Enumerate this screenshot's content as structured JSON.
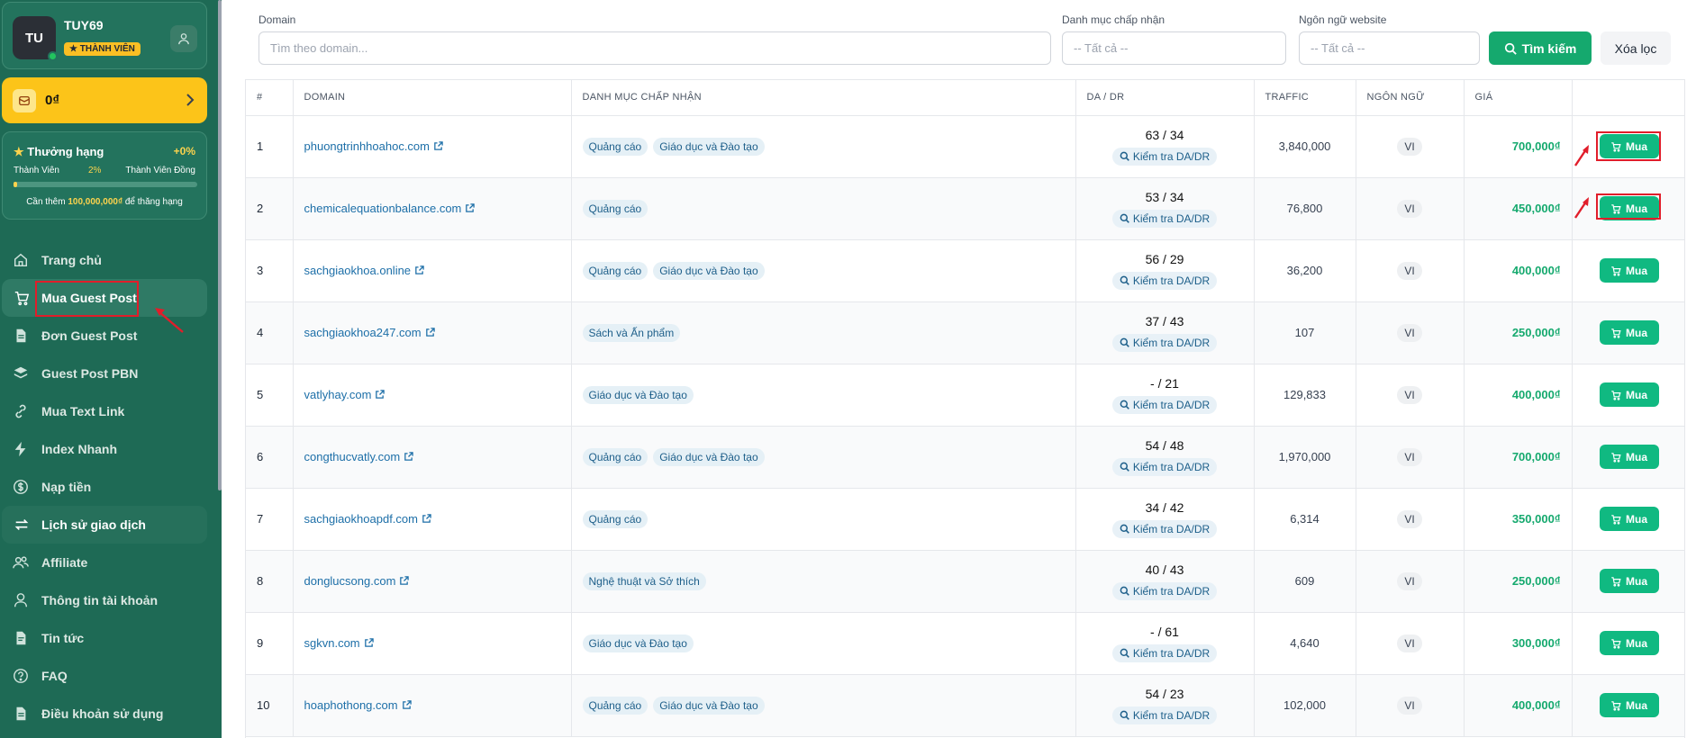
{
  "user": {
    "initials": "TU",
    "name": "TUY69",
    "badge": "★ THÀNH VIÊN"
  },
  "wallet": {
    "balance": "0₫"
  },
  "rank": {
    "title": "Thưởng hạng",
    "percent": "+0%",
    "from": "Thành Viên",
    "progress_label": "2%",
    "progress": 0.02,
    "to": "Thành Viên Đồng",
    "note_prefix": "Cần thêm ",
    "note_amount": "100,000,000₫",
    "note_suffix": " để thăng hạng"
  },
  "nav": [
    {
      "label": "Trang chủ",
      "icon": "home-icon"
    },
    {
      "label": "Mua Guest Post",
      "icon": "cart-icon"
    },
    {
      "label": "Đơn Guest Post",
      "icon": "document-icon"
    },
    {
      "label": "Guest Post PBN",
      "icon": "layers-icon"
    },
    {
      "label": "Mua Text Link",
      "icon": "link-icon"
    },
    {
      "label": "Index Nhanh",
      "icon": "bolt-icon"
    },
    {
      "label": "Nạp tiền",
      "icon": "dollar-icon"
    },
    {
      "label": "Lịch sử giao dịch",
      "icon": "swap-icon"
    },
    {
      "label": "Affiliate",
      "icon": "users-icon"
    },
    {
      "label": "Thông tin tài khoản",
      "icon": "user-icon"
    },
    {
      "label": "Tin tức",
      "icon": "news-icon"
    },
    {
      "label": "FAQ",
      "icon": "question-icon"
    },
    {
      "label": "Điều khoản sử dụng",
      "icon": "terms-icon"
    }
  ],
  "filters": {
    "domain_label": "Domain",
    "domain_placeholder": "Tìm theo domain...",
    "category_label": "Danh mục chấp nhận",
    "category_value": "-- Tất cả --",
    "lang_label": "Ngôn ngữ website",
    "lang_value": "-- Tất cả --",
    "search_button": "Tìm kiếm",
    "clear_button": "Xóa lọc"
  },
  "table": {
    "headers": [
      "#",
      "DOMAIN",
      "DANH MỤC CHẤP NHẬN",
      "DA / DR",
      "TRAFFIC",
      "NGÔN NGỮ",
      "GIÁ",
      ""
    ],
    "check_label": "Kiểm tra DA/DR",
    "buy_label": "Mua",
    "rows": [
      {
        "n": "1",
        "domain": "phuongtrinhhoahoc.com",
        "tags": [
          "Quảng cáo",
          "Giáo dục và Đào tạo"
        ],
        "da": "63 / 34",
        "traffic": "3,840,000",
        "lang": "VI",
        "price": "700,000₫"
      },
      {
        "n": "2",
        "domain": "chemicalequationbalance.com",
        "tags": [
          "Quảng cáo"
        ],
        "da": "53 / 34",
        "traffic": "76,800",
        "lang": "VI",
        "price": "450,000₫"
      },
      {
        "n": "3",
        "domain": "sachgiaokhoa.online",
        "tags": [
          "Quảng cáo",
          "Giáo dục và Đào tạo"
        ],
        "da": "56 / 29",
        "traffic": "36,200",
        "lang": "VI",
        "price": "400,000₫"
      },
      {
        "n": "4",
        "domain": "sachgiaokhoa247.com",
        "tags": [
          "Sách và Ấn phẩm"
        ],
        "da": "37 / 43",
        "traffic": "107",
        "lang": "VI",
        "price": "250,000₫"
      },
      {
        "n": "5",
        "domain": "vatlyhay.com",
        "tags": [
          "Giáo dục và Đào tạo"
        ],
        "da": "- / 21",
        "traffic": "129,833",
        "lang": "VI",
        "price": "400,000₫"
      },
      {
        "n": "6",
        "domain": "congthucvatly.com",
        "tags": [
          "Quảng cáo",
          "Giáo dục và Đào tạo"
        ],
        "da": "54 / 48",
        "traffic": "1,970,000",
        "lang": "VI",
        "price": "700,000₫"
      },
      {
        "n": "7",
        "domain": "sachgiaokhoapdf.com",
        "tags": [
          "Quảng cáo"
        ],
        "da": "34 / 42",
        "traffic": "6,314",
        "lang": "VI",
        "price": "350,000₫"
      },
      {
        "n": "8",
        "domain": "donglucsong.com",
        "tags": [
          "Nghệ thuật và Sở thích"
        ],
        "da": "40 / 43",
        "traffic": "609",
        "lang": "VI",
        "price": "250,000₫"
      },
      {
        "n": "9",
        "domain": "sgkvn.com",
        "tags": [
          "Giáo dục và Đào tạo"
        ],
        "da": "- / 61",
        "traffic": "4,640",
        "lang": "VI",
        "price": "300,000₫"
      },
      {
        "n": "10",
        "domain": "hoaphothong.com",
        "tags": [
          "Quảng cáo",
          "Giáo dục và Đào tạo"
        ],
        "da": "54 / 23",
        "traffic": "102,000",
        "lang": "VI",
        "price": "400,000₫"
      }
    ]
  }
}
